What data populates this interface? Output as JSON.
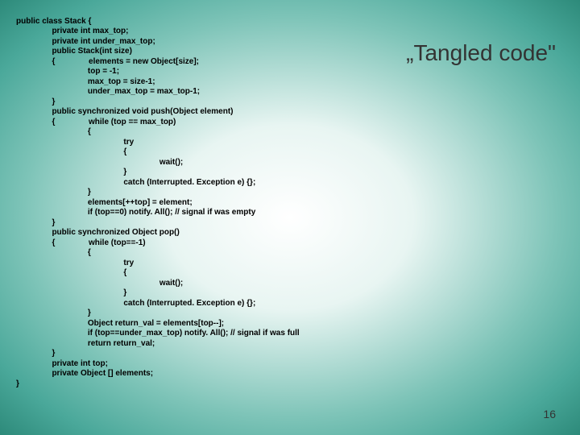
{
  "title": "„Tangled code\"",
  "page_number": "16",
  "code": {
    "l01": "public class Stack {",
    "l02": "                private int max_top;",
    "l03": "                private int under_max_top;",
    "l04": "                public Stack(int size)",
    "l05": "                {               elements = new Object[size];",
    "l06": "                                top = -1;",
    "l07": "                                max_top = size-1;",
    "l08": "                                under_max_top = max_top-1;",
    "l09": "                }",
    "l10": "                public synchronized void push(Object element)",
    "l11": "                {               while (top == max_top)",
    "l12": "                                {",
    "l13": "                                                try",
    "l14": "                                                {",
    "l15": "                                                                wait();",
    "l16": "                                                }",
    "l17": "                                                catch (Interrupted. Exception e) {};",
    "l18": "                                }",
    "l19": "                                elements[++top] = element;",
    "l20": "                                if (top==0) notify. All(); // signal if was empty",
    "l21": "                }",
    "l22": "                public synchronized Object pop()",
    "l23": "                {               while (top==-1)",
    "l24": "                                {",
    "l25": "                                                try",
    "l26": "                                                {",
    "l27": "                                                                wait();",
    "l28": "                                                }",
    "l29": "                                                catch (Interrupted. Exception e) {};",
    "l30": "                                }",
    "l31": "                                Object return_val = elements[top--];",
    "l32": "                                if (top==under_max_top) notify. All(); // signal if was full",
    "l33": "                                return return_val;",
    "l34": "                }",
    "l35": "                private int top;",
    "l36": "                private Object [] elements;",
    "l37": "}"
  }
}
